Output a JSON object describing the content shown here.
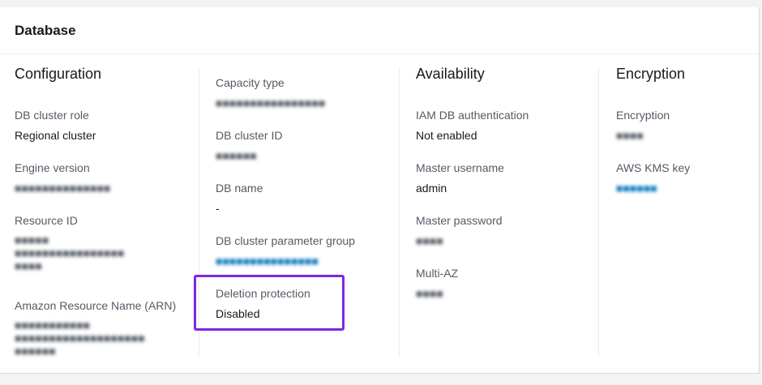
{
  "panel": {
    "title": "Database"
  },
  "columns": {
    "configuration": {
      "heading": "Configuration",
      "db_cluster_role": {
        "label": "DB cluster role",
        "value": "Regional cluster"
      },
      "engine_version": {
        "label": "Engine version",
        "value": ""
      },
      "resource_id": {
        "label": "Resource ID",
        "value": ""
      },
      "arn": {
        "label": "Amazon Resource Name (ARN)",
        "value": ""
      }
    },
    "capacity": {
      "capacity_type": {
        "label": "Capacity type",
        "value": ""
      },
      "db_cluster_id": {
        "label": "DB cluster ID",
        "value": ""
      },
      "db_name": {
        "label": "DB name",
        "value": "-"
      },
      "param_group": {
        "label": "DB cluster parameter group",
        "value": ""
      },
      "deletion_protection": {
        "label": "Deletion protection",
        "value": "Disabled"
      }
    },
    "availability": {
      "heading": "Availability",
      "iam_auth": {
        "label": "IAM DB authentication",
        "value": "Not enabled"
      },
      "master_username": {
        "label": "Master username",
        "value": "admin"
      },
      "master_password": {
        "label": "Master password",
        "value": ""
      },
      "multi_az": {
        "label": "Multi-AZ",
        "value": ""
      }
    },
    "encryption": {
      "heading": "Encryption",
      "encryption": {
        "label": "Encryption",
        "value": ""
      },
      "kms_key": {
        "label": "AWS KMS key",
        "value": ""
      }
    }
  },
  "colors": {
    "highlight": "#7e26e0",
    "link": "#0073bb",
    "label": "#545b64"
  }
}
